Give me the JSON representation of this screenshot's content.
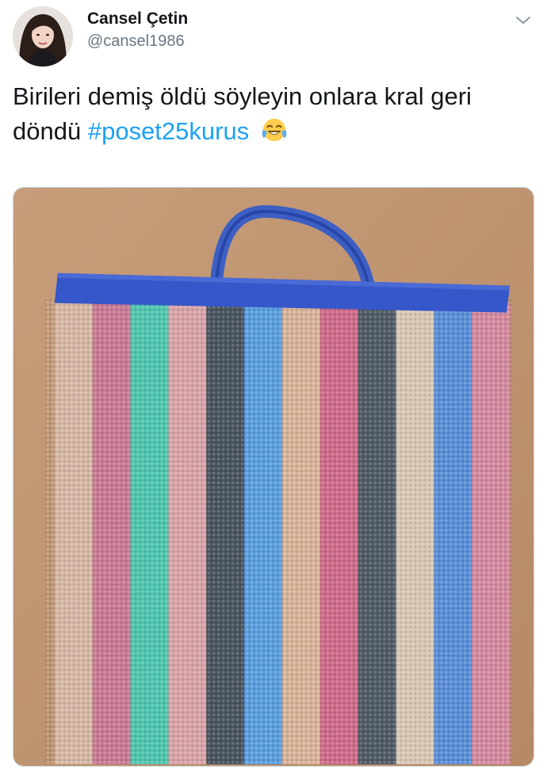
{
  "tweet": {
    "display_name": "Cansel Çetin",
    "handle": "@cansel1986",
    "text_main": "Birileri demiş öldü söyleyin onlara kral geri döndü",
    "hashtag": "#poset25kurus",
    "emoji": "face-with-tears-of-joy"
  },
  "icons": {
    "menu": "chevron-down-icon"
  },
  "colors": {
    "hashtag": "#1da1f2",
    "handle": "#657786",
    "text": "#14171a"
  },
  "media": {
    "subject": "striped-woven-shopping-bag",
    "stripe_colors": [
      "#d7b8a5",
      "#c97a95",
      "#4fc6b0",
      "#d9a4a8",
      "#4a5560",
      "#5a9fe0",
      "#d9b39a",
      "#cf6b8a",
      "#505b66",
      "#d8c7b5",
      "#5a8fd8",
      "#d58aa0"
    ]
  }
}
